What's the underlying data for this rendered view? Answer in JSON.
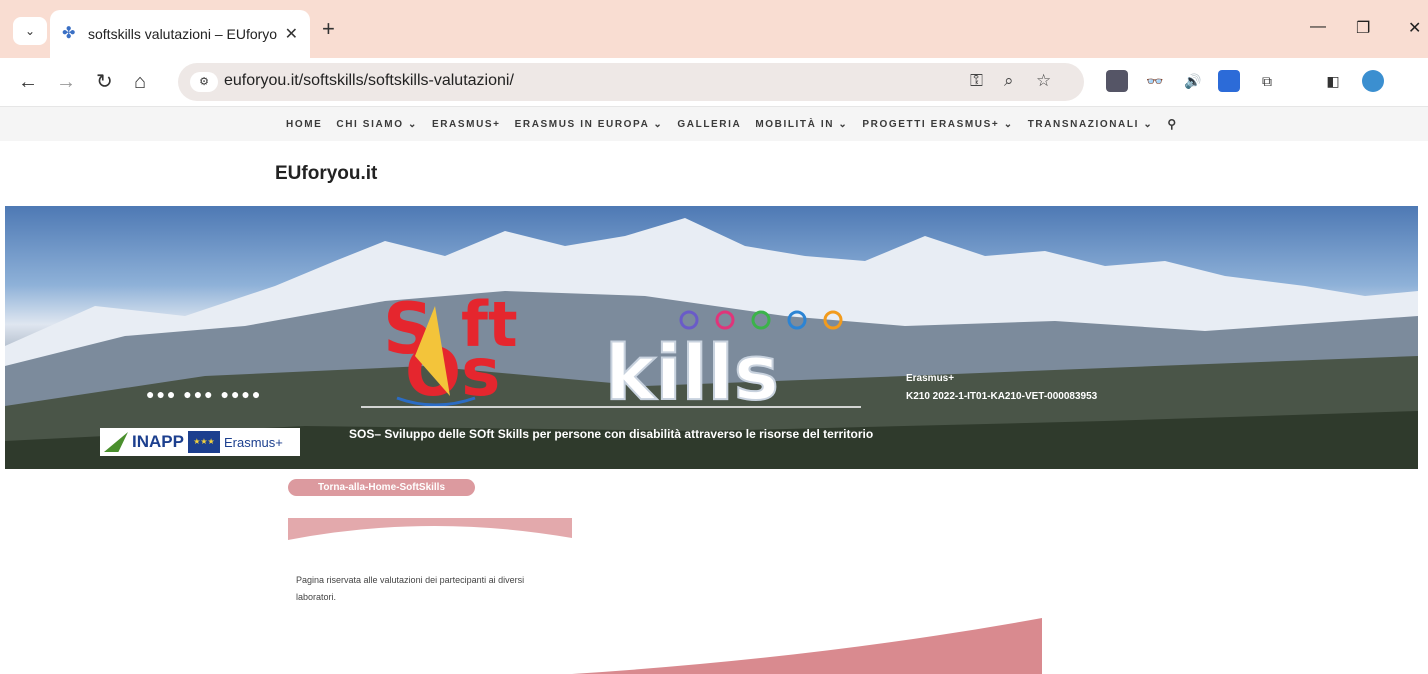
{
  "browser": {
    "tab_title": "softskills valutazioni – EUforyou",
    "url": "euforyou.it/softskills/softskills-valutazioni/"
  },
  "site": {
    "title": "EUforyou.it",
    "menu": [
      "HOME",
      "CHI SIAMO ⌄",
      "ERASMUS+",
      "ERASMUS IN EUROPA ⌄",
      "GALLERIA",
      "MOBILITÀ IN ⌄",
      "PROGETTI ERASMUS+ ⌄",
      "TRANSNAZIONALI ⌄"
    ]
  },
  "hero": {
    "logo_top": "S",
    "logo_ft": "ft",
    "logo_os": "Os",
    "logo_kills": "kills",
    "dots": "●●● ●●● ●●●●",
    "erasmus_label": "Erasmus+",
    "project_code": "K210 2022-1-IT01-KA210-VET-000083953",
    "tagline": "SOS– Sviluppo delle SOft Skills per persone con disabilità attraverso le risorse del territorio",
    "inapp": "INAPP",
    "inapp_sub": "Erasmus+"
  },
  "content": {
    "back_button": "Torna-alla-Home-SoftSkills",
    "intro": "Pagina riservata alle valutazioni dei partecipanti ai diversi laboratori."
  },
  "colors": {
    "tab_strip": "#f9ddd2",
    "accent_pink": "#dc9a9f",
    "logo_red": "#e5262e"
  }
}
